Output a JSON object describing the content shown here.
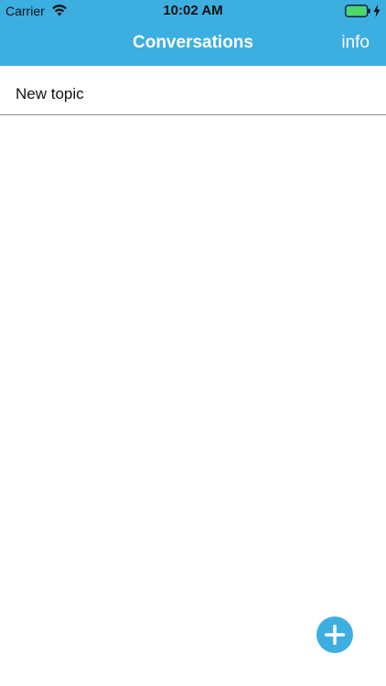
{
  "status": {
    "carrier": "Carrier",
    "time": "10:02 AM",
    "wifi_icon": "wifi-icon",
    "battery_icon": "battery-icon",
    "battery_level": 1.0,
    "battery_color": "#4cd964",
    "charging_icon": "charging-bolt-icon"
  },
  "navbar": {
    "title": "Conversations",
    "info_label": "info",
    "background": "#3daee0"
  },
  "conversations": [
    {
      "label": "New topic"
    }
  ],
  "fab": {
    "icon": "plus-icon",
    "color": "#3daee0"
  }
}
